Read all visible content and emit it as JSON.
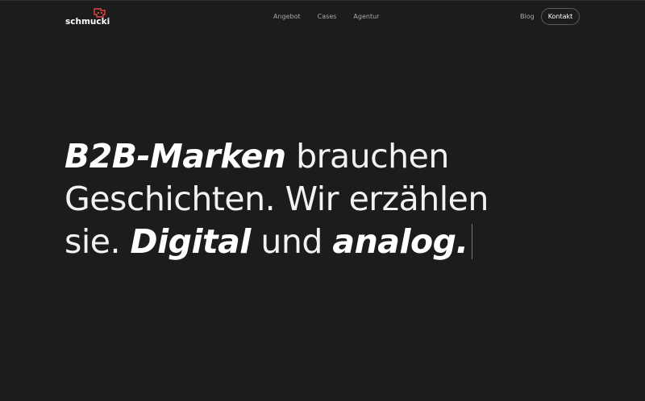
{
  "header": {
    "logo_text": "schmucki",
    "nav": [
      {
        "label": "Angebot"
      },
      {
        "label": "Cases"
      },
      {
        "label": "Agentur"
      }
    ],
    "blog_label": "Blog",
    "contact_label": "Kontakt"
  },
  "hero": {
    "line1_em": "B2B-Marken",
    "line1_rest": " brauchen",
    "line2": "Geschichten. Wir erzählen",
    "line3_start": "sie. ",
    "line3_em1": "Digital",
    "line3_mid": " und ",
    "line3_em2": "analog."
  },
  "colors": {
    "background": "#1c1c1c",
    "accent": "#e4453f",
    "text": "#ffffff",
    "nav_text": "#a8a8a8"
  }
}
